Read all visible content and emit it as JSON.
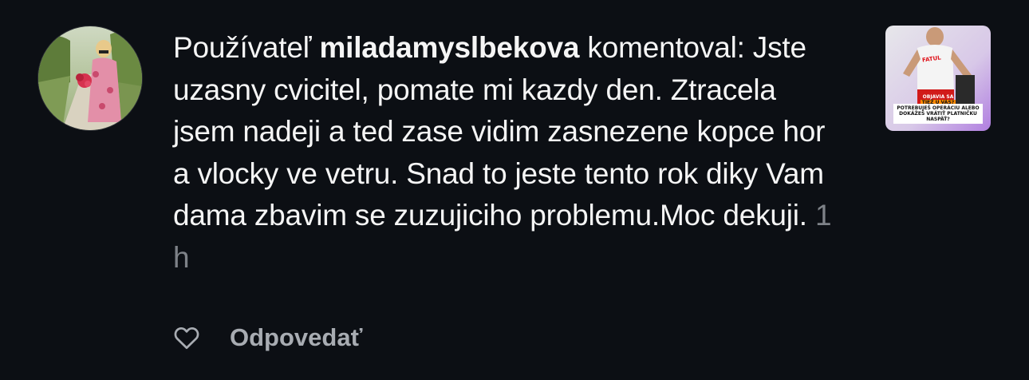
{
  "comment": {
    "prefix": "Používateľ",
    "username": "miladamyslbekova",
    "verb": "komentoval:",
    "text": "Jste uzasny cvicitel, pomate mi kazdy den. Ztracela jsem nadeji a ted zase vidim zasnezene kopce hor a vlocky ve vetru. Snad to jeste tento rok diky Vam dama zbavim se zuzujiciho problemu.Moc dekuji.",
    "time": "1 h"
  },
  "thumbnail": {
    "brand": "FATUL",
    "tag_line1": "OBJAVIA SA",
    "tag_line2": "TIEŽ U VÁS?",
    "headline": "POTREBUJEŠ OPERÁCIU ALEBO DOKÁŽEŠ VRÁTIŤ PLATNIČKU NASPÄŤ?"
  },
  "actions": {
    "like_icon": "heart-outline-icon",
    "reply_label": "Odpovedať"
  },
  "colors": {
    "background": "#0c0f14",
    "text": "#f5f5f5",
    "muted": "#7e8288",
    "reply": "#a8acb2"
  }
}
